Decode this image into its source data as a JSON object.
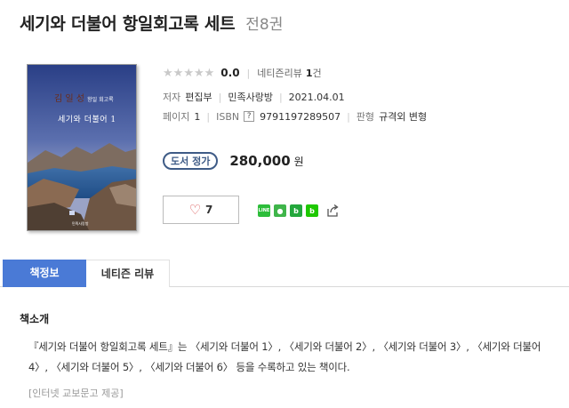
{
  "header": {
    "title": "세기와 더불어 항일회고록 세트",
    "volumes": "전8권"
  },
  "cover": {
    "author": "김 일 성",
    "author_sub": "항일 회고록",
    "title": "세기와 더불어 1",
    "publisher": "민족사랑방"
  },
  "rating": {
    "stars_filled": 0,
    "stars_total": 5,
    "score": "0.0",
    "review_label": "네티즌리뷰",
    "review_count": "1",
    "review_unit": "건"
  },
  "info": {
    "author_label": "저자",
    "author": "편집부",
    "publisher": "민족사랑방",
    "date": "2021.04.01",
    "pages_label": "페이지",
    "pages": "1",
    "isbn_label": "ISBN",
    "isbn_help": "?",
    "isbn": "9791197289507",
    "format_label": "판형",
    "format": "규격외 변형"
  },
  "price": {
    "badge": "도서 정가",
    "amount": "280,000",
    "unit": "원"
  },
  "like": {
    "count": "7"
  },
  "share": {
    "icons": [
      "line-icon",
      "kakaotalk-icon",
      "band-icon",
      "blog-icon",
      "share-icon"
    ],
    "line_label": "LINE",
    "talk_label": "●",
    "band_label": "b",
    "blog_label": "b"
  },
  "tabs": [
    {
      "label": "책정보",
      "active": true
    },
    {
      "label": "네티즌 리뷰",
      "active": false
    }
  ],
  "intro": {
    "heading": "책소개",
    "text": "『세기와 더불어 항일회고록 세트』는 〈세기와 더불어 1〉, 〈세기와 더불어 2〉, 〈세기와 더불어 3〉, 〈세기와 더불어 4〉, 〈세기와 더불어 5〉, 〈세기와 더불어 6〉 등을 수록하고 있는 책이다.",
    "source": "[인터넷 교보문고 제공]"
  },
  "colors": {
    "accent": "#4a7ad6",
    "badge": "#3e5b86",
    "heart": "#d85050"
  }
}
